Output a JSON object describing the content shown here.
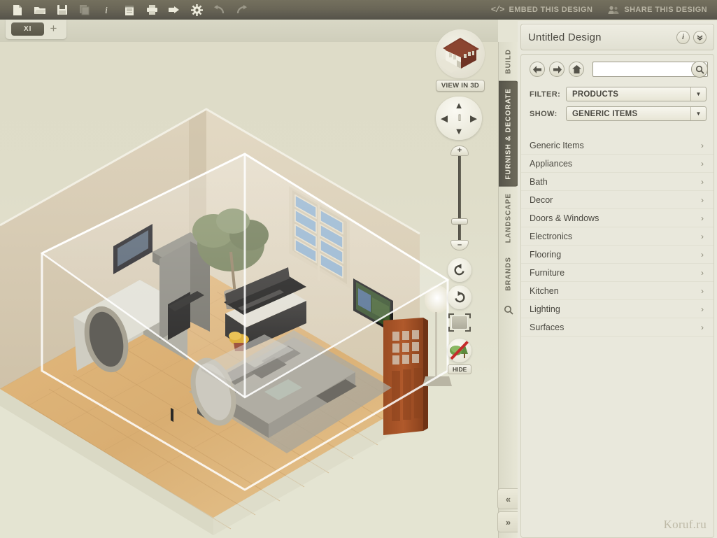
{
  "toolbar": {
    "icons": [
      {
        "name": "new-file-icon",
        "title": "New",
        "dim": false
      },
      {
        "name": "open-folder-icon",
        "title": "Open",
        "dim": false
      },
      {
        "name": "save-disk-icon",
        "title": "Save",
        "dim": false
      },
      {
        "name": "copy-icon",
        "title": "Copy",
        "dim": true
      },
      {
        "name": "info-icon",
        "title": "Info",
        "dim": false
      },
      {
        "name": "notes-icon",
        "title": "Notes",
        "dim": false
      },
      {
        "name": "print-icon",
        "title": "Print",
        "dim": false
      },
      {
        "name": "export-icon",
        "title": "Export",
        "dim": false
      },
      {
        "name": "settings-gear-icon",
        "title": "Settings",
        "dim": false
      },
      {
        "name": "undo-icon",
        "title": "Undo",
        "dim": true
      },
      {
        "name": "redo-icon",
        "title": "Redo",
        "dim": true
      }
    ],
    "embed_label": "EMBED THIS DESIGN",
    "embed_glyph": "</>",
    "share_label": "SHARE THIS DESIGN"
  },
  "tabbar": {
    "document_tab": "XI",
    "add_tab": "+"
  },
  "viewcontrols": {
    "view_in_3d": "VIEW IN 3D",
    "nav_up": "▲",
    "nav_down": "▼",
    "nav_left": "◀",
    "nav_right": "▶",
    "nav_center": "[ ]",
    "zoom_in": "+",
    "zoom_out": "–",
    "hide_label": "HIDE"
  },
  "verticaltabs": {
    "items": [
      {
        "label": "BUILD",
        "active": false
      },
      {
        "label": "FURNISH & DECORATE",
        "active": true
      },
      {
        "label": "LANDSCAPE",
        "active": false
      },
      {
        "label": "BRANDS",
        "active": false
      }
    ],
    "search_icon": "search-icon"
  },
  "collapse": {
    "collapse_label": "«",
    "expand_label": "»"
  },
  "panel": {
    "title": "Untitled Design",
    "info_label": "i",
    "collapse_label": "⌄",
    "search": {
      "value": "",
      "placeholder": ""
    },
    "filter": {
      "label": "FILTER:",
      "value": "PRODUCTS"
    },
    "show": {
      "label": "SHOW:",
      "value": "GENERIC ITEMS"
    },
    "categories": [
      {
        "label": "Generic Items"
      },
      {
        "label": "Appliances"
      },
      {
        "label": "Bath"
      },
      {
        "label": "Decor"
      },
      {
        "label": "Doors & Windows"
      },
      {
        "label": "Electronics"
      },
      {
        "label": "Flooring"
      },
      {
        "label": "Furniture"
      },
      {
        "label": "Kitchen"
      },
      {
        "label": "Lighting"
      },
      {
        "label": "Surfaces"
      }
    ],
    "chevron": "›",
    "watermark": "Koruf.ru"
  },
  "colors": {
    "toolbar_top": "#74705e",
    "toolbar_bottom": "#55534a",
    "panel_bg": "#e9e8dc",
    "canvas_bg": "#e2e1cf",
    "wall": "#d9cdb6",
    "floor": "#d8aa6e",
    "accent_dark": "#4a4840"
  }
}
